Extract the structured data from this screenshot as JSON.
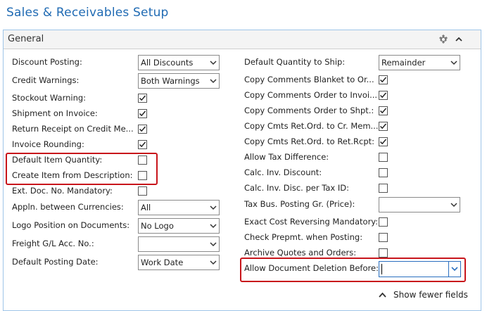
{
  "page": {
    "title": "Sales & Receivables Setup"
  },
  "panel": {
    "title": "General",
    "show_fewer_label": "Show fewer fields"
  },
  "left_fields": [
    {
      "label": "Discount Posting:",
      "type": "select",
      "value": "All Discounts"
    },
    {
      "label": "Credit Warnings:",
      "type": "select",
      "value": "Both Warnings"
    },
    {
      "label": "Stockout Warning:",
      "type": "checkbox",
      "checked": true
    },
    {
      "label": "Shipment on Invoice:",
      "type": "checkbox",
      "checked": true
    },
    {
      "label": "Return Receipt on Credit Me...",
      "type": "checkbox",
      "checked": true
    },
    {
      "label": "Invoice Rounding:",
      "type": "checkbox",
      "checked": true
    },
    {
      "label": "Default Item Quantity:",
      "type": "checkbox",
      "checked": false
    },
    {
      "label": "Create Item from Description:",
      "type": "checkbox",
      "checked": false
    },
    {
      "label": "Ext. Doc. No. Mandatory:",
      "type": "checkbox",
      "checked": false
    },
    {
      "label": "Appln. between Currencies:",
      "type": "select",
      "value": "All"
    },
    {
      "label": "Logo Position on Documents:",
      "type": "select",
      "value": "No Logo"
    },
    {
      "label": "Freight G/L Acc. No.:",
      "type": "select",
      "value": ""
    },
    {
      "label": "Default Posting Date:",
      "type": "select",
      "value": "Work Date"
    }
  ],
  "right_fields": [
    {
      "label": "Default Quantity to Ship:",
      "type": "select",
      "value": "Remainder"
    },
    {
      "label": "Copy Comments Blanket to Or...",
      "type": "checkbox",
      "checked": true
    },
    {
      "label": "Copy Comments Order to Invoi...",
      "type": "checkbox",
      "checked": true
    },
    {
      "label": "Copy Comments Order to Shpt.:",
      "type": "checkbox",
      "checked": true
    },
    {
      "label": "Copy Cmts Ret.Ord. to Cr. Mem...",
      "type": "checkbox",
      "checked": true
    },
    {
      "label": "Copy Cmts Ret.Ord. to Ret.Rcpt:",
      "type": "checkbox",
      "checked": true
    },
    {
      "label": "Allow Tax Difference:",
      "type": "checkbox",
      "checked": false
    },
    {
      "label": "Calc. Inv. Discount:",
      "type": "checkbox",
      "checked": false
    },
    {
      "label": "Calc. Inv. Disc. per Tax ID:",
      "type": "checkbox",
      "checked": false
    },
    {
      "label": "Tax Bus. Posting Gr. (Price):",
      "type": "select",
      "value": ""
    },
    {
      "label": "Exact Cost Reversing Mandatory:",
      "type": "checkbox",
      "checked": false
    },
    {
      "label": "Check Prepmt. when Posting:",
      "type": "checkbox",
      "checked": false
    },
    {
      "label": "Archive Quotes and Orders:",
      "type": "checkbox",
      "checked": false
    },
    {
      "label": "Allow Document Deletion Before:",
      "type": "date-input",
      "value": ""
    }
  ],
  "icons": {
    "personalize": "puzzle-icon",
    "collapse": "chevron-up-icon",
    "show_fewer": "chevron-up-icon",
    "dropdown": "chevron-down-icon"
  },
  "colors": {
    "title": "#1f6ab3",
    "highlight": "#c8151b",
    "panel_border": "#9fc5e8",
    "focus_border": "#2a6fbf"
  }
}
